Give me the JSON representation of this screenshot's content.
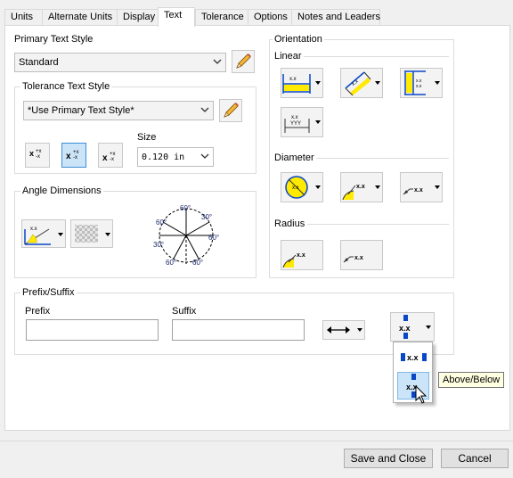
{
  "tabs": [
    {
      "label": "Units"
    },
    {
      "label": "Alternate Units"
    },
    {
      "label": "Display"
    },
    {
      "label": "Text"
    },
    {
      "label": "Tolerance"
    },
    {
      "label": "Options"
    },
    {
      "label": "Notes and Leaders"
    }
  ],
  "active_tab": "Text",
  "primary_text_style": {
    "label": "Primary Text Style",
    "value": "Standard"
  },
  "tolerance_text_style": {
    "label": "Tolerance Text Style",
    "value": "*Use Primary Text Style*"
  },
  "size": {
    "label": "Size",
    "value": "0.120 in"
  },
  "angle_dimensions": {
    "label": "Angle Dimensions",
    "dial_labels": [
      "60°",
      "30°",
      "60°",
      "60°",
      "60°",
      "30°",
      "60°"
    ]
  },
  "orientation": {
    "label": "Orientation",
    "linear_label": "Linear",
    "diameter_label": "Diameter",
    "radius_label": "Radius",
    "sample_text": "x.x"
  },
  "prefix_suffix": {
    "label": "Prefix/Suffix",
    "prefix_label": "Prefix",
    "prefix_value": "",
    "suffix_label": "Suffix",
    "suffix_value": "",
    "sample_text": "x.x"
  },
  "placement_dropdown": {
    "option_text": "x.x",
    "tooltip": "Above/Below"
  },
  "footer": {
    "save_close": "Save and Close",
    "cancel": "Cancel"
  },
  "colors": {
    "accent_blue": "#0a47c8",
    "highlight_yellow": "#ffea00",
    "selected_bg": "#cce4f7"
  }
}
